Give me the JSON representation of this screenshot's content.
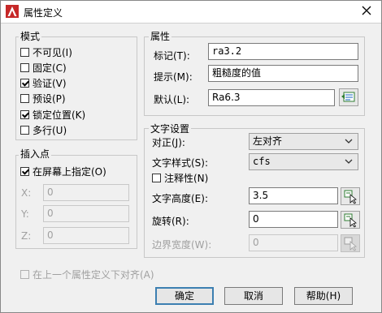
{
  "title": "属性定义",
  "mode": {
    "label": "模式",
    "items": [
      {
        "label": "不可见(I)",
        "checked": false
      },
      {
        "label": "固定(C)",
        "checked": false
      },
      {
        "label": "验证(V)",
        "checked": true
      },
      {
        "label": "预设(P)",
        "checked": false
      },
      {
        "label": "锁定位置(K)",
        "checked": true
      },
      {
        "label": "多行(U)",
        "checked": false
      }
    ]
  },
  "insertion": {
    "label": "插入点",
    "on_screen_label": "在屏幕上指定(O)",
    "on_screen_checked": true,
    "x_label": "X:",
    "x_value": "0",
    "y_label": "Y:",
    "y_value": "0",
    "z_label": "Z:",
    "z_value": "0"
  },
  "attribute": {
    "label": "属性",
    "tag_label": "标记(T):",
    "tag_value": "ra3.2",
    "prompt_label": "提示(M):",
    "prompt_value": "粗糙度的值",
    "default_label": "默认(L):",
    "default_value": "Ra6.3"
  },
  "text": {
    "label": "文字设置",
    "justify_label": "对正(J):",
    "justify_value": "左对齐",
    "style_label": "文字样式(S):",
    "style_value": "cfs",
    "annotative_label": "注释性(N)",
    "annotative_checked": false,
    "height_label": "文字高度(E):",
    "height_value": "3.5",
    "rotation_label": "旋转(R):",
    "rotation_value": "0",
    "width_label": "边界宽度(W):",
    "width_value": "0"
  },
  "align_below_label": "在上一个属性定义下对齐(A)",
  "buttons": {
    "ok": "确定",
    "cancel": "取消",
    "help": "帮助(H)"
  },
  "colors": {
    "accent": "#3c7fb1",
    "app_icon": "#d32f2f"
  }
}
